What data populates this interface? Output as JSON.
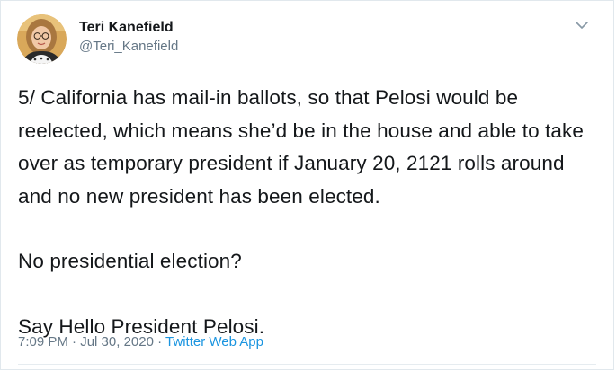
{
  "author": {
    "name": "Teri Kanefield",
    "handle": "@Teri_Kanefield"
  },
  "header": {
    "menu_icon": "chevron-down-icon"
  },
  "tweet": {
    "paragraphs": [
      "5/ California has mail-in ballots, so that Pelosi would be reelected, which means she’d be in the house and able to take over as temporary president if January 20, 2121 rolls around and no new president has been elected.",
      "No presidential election?",
      "Say Hello President Pelosi."
    ]
  },
  "meta": {
    "time": "7:09 PM",
    "separator": "·",
    "date": "Jul 30, 2020",
    "source": "Twitter Web App"
  },
  "colors": {
    "link": "#1b95e0",
    "secondary_text": "#657786",
    "primary_text": "#14171a",
    "border": "#e1e8ed"
  }
}
